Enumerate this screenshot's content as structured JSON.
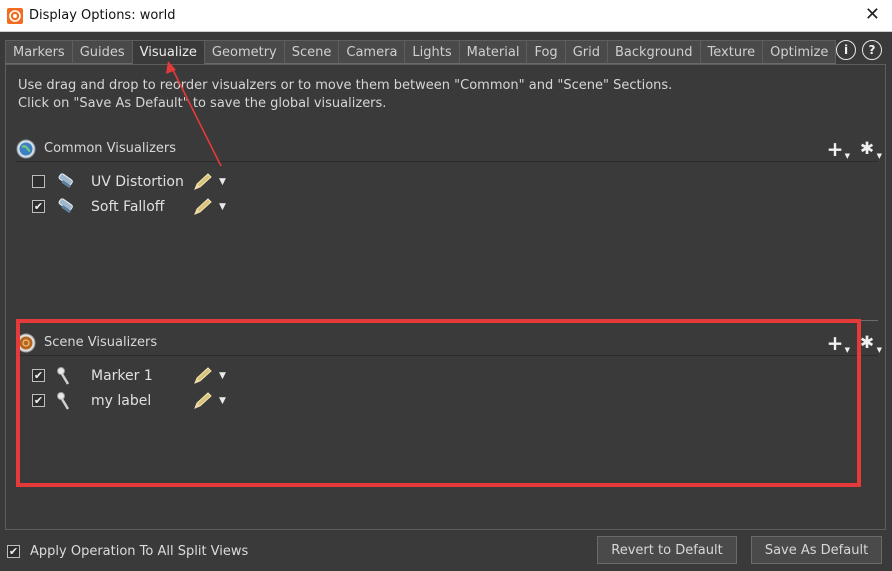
{
  "window": {
    "title": "Display Options:  world",
    "close_symbol": "✕"
  },
  "tabs": [
    {
      "label": "Markers"
    },
    {
      "label": "Guides"
    },
    {
      "label": "Visualize"
    },
    {
      "label": "Geometry"
    },
    {
      "label": "Scene"
    },
    {
      "label": "Camera"
    },
    {
      "label": "Lights"
    },
    {
      "label": "Material"
    },
    {
      "label": "Fog"
    },
    {
      "label": "Grid"
    },
    {
      "label": "Background"
    },
    {
      "label": "Texture"
    },
    {
      "label": "Optimize"
    }
  ],
  "active_tab": "Visualize",
  "help": {
    "info_label": "i",
    "question_label": "?"
  },
  "instructions": {
    "line1": "Use drag and drop to reorder visualzers or to move them between \"Common\" and \"Scene\" Sections.",
    "line2": "Click on \"Save As Default\" to save the global visualizers."
  },
  "common": {
    "title": "Common Visualizers",
    "items": [
      {
        "label": "UV Distortion",
        "checked": false
      },
      {
        "label": "Soft Falloff",
        "checked": true
      }
    ]
  },
  "scene": {
    "title": "Scene Visualizers",
    "items": [
      {
        "label": "Marker 1",
        "checked": true
      },
      {
        "label": "my label",
        "checked": true
      }
    ]
  },
  "tools": {
    "add_symbol": "+",
    "gear_symbol": "✱",
    "caret_symbol": "▼"
  },
  "footer": {
    "apply_label": "Apply Operation To All Split Views",
    "apply_checked": true,
    "revert_label": "Revert to Default",
    "save_label": "Save As Default"
  },
  "colors": {
    "highlight": "#e53a3a",
    "background": "#3a3a3a"
  }
}
